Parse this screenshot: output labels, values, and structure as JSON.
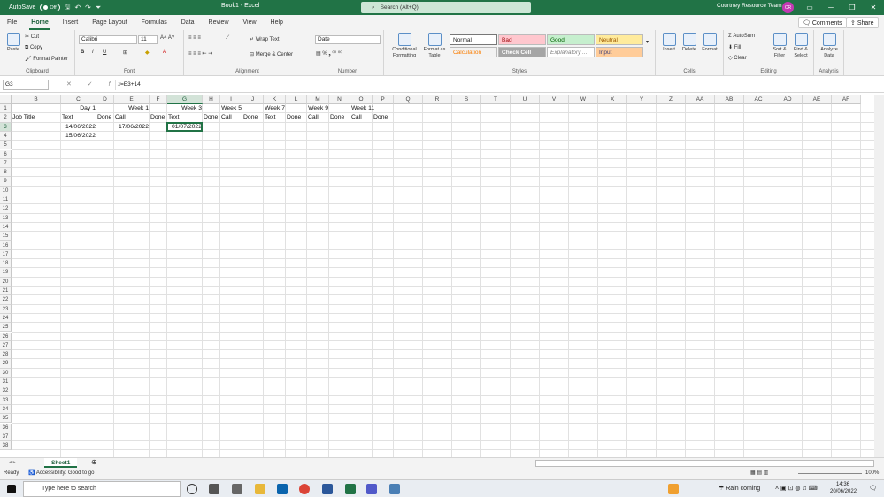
{
  "titlebar": {
    "autosave": "AutoSave",
    "toggle": "Off",
    "book": "Book1 - Excel",
    "search": "Search (Alt+Q)",
    "user": "Courtney Resource Team",
    "initials": "CR"
  },
  "menu": {
    "tabs": [
      "File",
      "Home",
      "Insert",
      "Page Layout",
      "Formulas",
      "Data",
      "Review",
      "View",
      "Help"
    ],
    "active": "Home",
    "comments": "Comments",
    "share": "Share"
  },
  "ribbon": {
    "clipboard": {
      "paste": "Paste",
      "cut": "Cut",
      "copy": "Copy",
      "format_painter": "Format Painter",
      "label": "Clipboard"
    },
    "font": {
      "name": "Calibri",
      "size": "11",
      "label": "Font"
    },
    "alignment": {
      "wrap": "Wrap Text",
      "merge": "Merge & Center",
      "label": "Alignment"
    },
    "number": {
      "format": "Date",
      "label": "Number"
    },
    "styles": {
      "conditional": "Conditional Formatting",
      "format_table": "Format as Table",
      "normal": "Normal",
      "bad": "Bad",
      "good": "Good",
      "neutral": "Neutral",
      "calculation": "Calculation",
      "check": "Check Cell",
      "explanatory": "Explanatory ...",
      "input": "Input",
      "label": "Styles"
    },
    "cells": {
      "insert": "Insert",
      "delete": "Delete",
      "format": "Format",
      "label": "Cells"
    },
    "editing": {
      "autosum": "AutoSum",
      "fill": "Fill",
      "clear": "Clear",
      "sort": "Sort & Filter",
      "find": "Find & Select",
      "label": "Editing"
    },
    "analysis": {
      "analyze": "Analyze Data",
      "label": "Analysis"
    }
  },
  "formula_bar": {
    "name_box": "G3",
    "formula": "=E3+14"
  },
  "columns": [
    "B",
    "C",
    "D",
    "E",
    "F",
    "G",
    "H",
    "I",
    "J",
    "K",
    "L",
    "M",
    "N",
    "O",
    "P",
    "Q",
    "R",
    "S",
    "T",
    "U",
    "V",
    "W",
    "X",
    "Y",
    "Z",
    "AA",
    "AB",
    "AC",
    "AD",
    "AE",
    "AF"
  ],
  "rows": [
    "1",
    "2",
    "3",
    "4",
    "5",
    "6",
    "7",
    "8",
    "9",
    "10",
    "11",
    "12",
    "13",
    "14",
    "15",
    "16",
    "17",
    "18",
    "19",
    "20",
    "21",
    "22",
    "23",
    "24",
    "25",
    "26",
    "27",
    "28",
    "29",
    "30",
    "31",
    "32",
    "33",
    "34",
    "35",
    "36",
    "37",
    "38"
  ],
  "cells": {
    "r1": {
      "c": "Day 1",
      "e": "Week 1",
      "g": "Week 3",
      "i": "Week 5",
      "k": "Week 7",
      "m": "Week 9",
      "o": "Week 11"
    },
    "r2": {
      "b": "Job Title",
      "c": "Text",
      "d": "Done",
      "e": "Call",
      "f": "Done",
      "g": "Text",
      "h": "Done",
      "i": "Call",
      "j": "Done",
      "k": "Text",
      "l": "Done",
      "m": "Call",
      "n": "Done",
      "o": "Call",
      "p": "Done"
    },
    "r3": {
      "c": "14/06/2022",
      "e": "17/06/2022",
      "g": "01/07/2022"
    },
    "r4": {
      "c": "15/06/2022"
    }
  },
  "sheet_tab": "Sheet1",
  "status": {
    "ready": "Ready",
    "accessibility": "Accessibility: Good to go",
    "zoom": "100%"
  },
  "taskbar": {
    "search": "Type here to search",
    "weather": "Rain coming",
    "time": "14:36",
    "date": "20/06/2022"
  }
}
